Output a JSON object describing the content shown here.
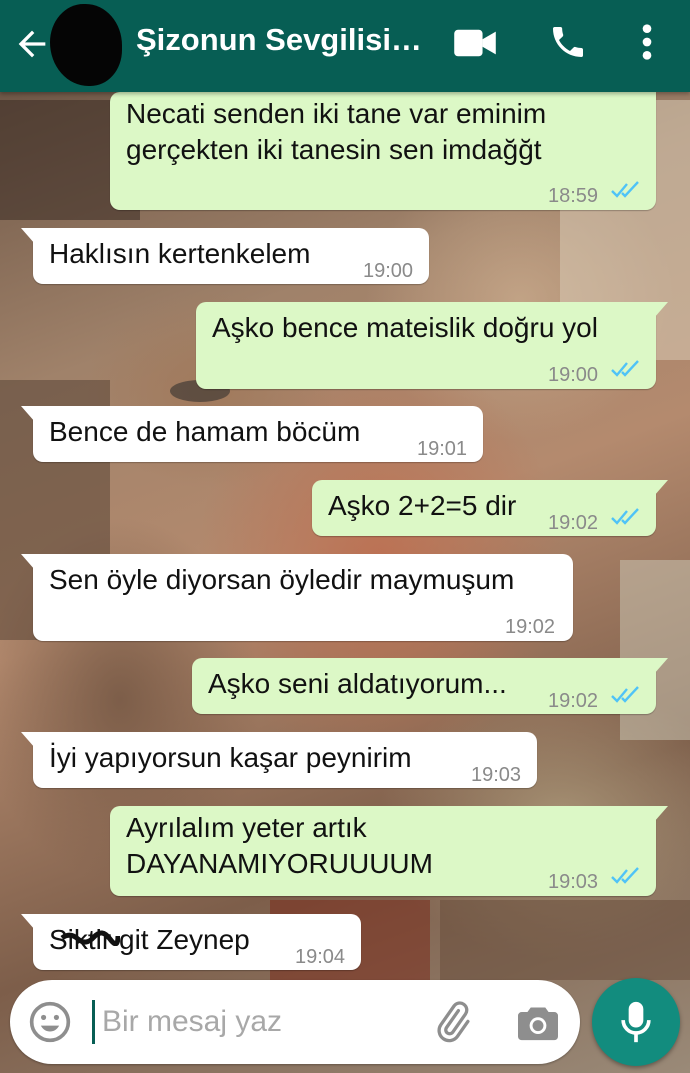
{
  "header": {
    "title": "Şizonun Sevgilisi…",
    "background": "#075e54"
  },
  "icons": {
    "back": "arrow-left-icon",
    "video": "video-call-icon",
    "call": "phone-icon",
    "menu": "more-vert-icon",
    "emoji": "emoji-icon",
    "attach": "paperclip-icon",
    "camera": "camera-icon",
    "mic": "mic-icon"
  },
  "messages": [
    {
      "direction": "out",
      "lines": [
        "Necati senden iki tane var eminim",
        "gerçekten iki tanesin sen imdağğt"
      ],
      "time": "18:59",
      "read": true
    },
    {
      "direction": "in",
      "lines": [
        "Haklısın kertenkelem"
      ],
      "time": "19:00"
    },
    {
      "direction": "out",
      "lines": [
        "Aşko bence mateislik doğru yol"
      ],
      "time": "19:00",
      "read": true
    },
    {
      "direction": "in",
      "lines": [
        "Bence de hamam böcüm"
      ],
      "time": "19:01"
    },
    {
      "direction": "out",
      "lines": [
        "Aşko 2+2=5 dir"
      ],
      "time": "19:02",
      "read": true
    },
    {
      "direction": "in",
      "lines": [
        "Sen öyle diyorsan öyledir maymuşum"
      ],
      "time": "19:02"
    },
    {
      "direction": "out",
      "lines": [
        "Aşko seni aldatıyorum..."
      ],
      "time": "19:02",
      "read": true
    },
    {
      "direction": "in",
      "lines": [
        "İyi yapıyorsun kaşar peynirim"
      ],
      "time": "19:03"
    },
    {
      "direction": "out",
      "lines": [
        "Ayrılalım yeter artık",
        "DAYANAMIYORUUUUM"
      ],
      "time": "19:03",
      "read": true
    },
    {
      "direction": "in",
      "lines": [
        "Siktir git Zeynep"
      ],
      "time": "19:04"
    }
  ],
  "composer": {
    "placeholder": "Bir mesaj yaz"
  },
  "colors": {
    "outgoing": "#dcf8c6",
    "incoming": "#ffffff",
    "read_ticks": "#4fc3f7",
    "mic_button": "#128c7e"
  }
}
